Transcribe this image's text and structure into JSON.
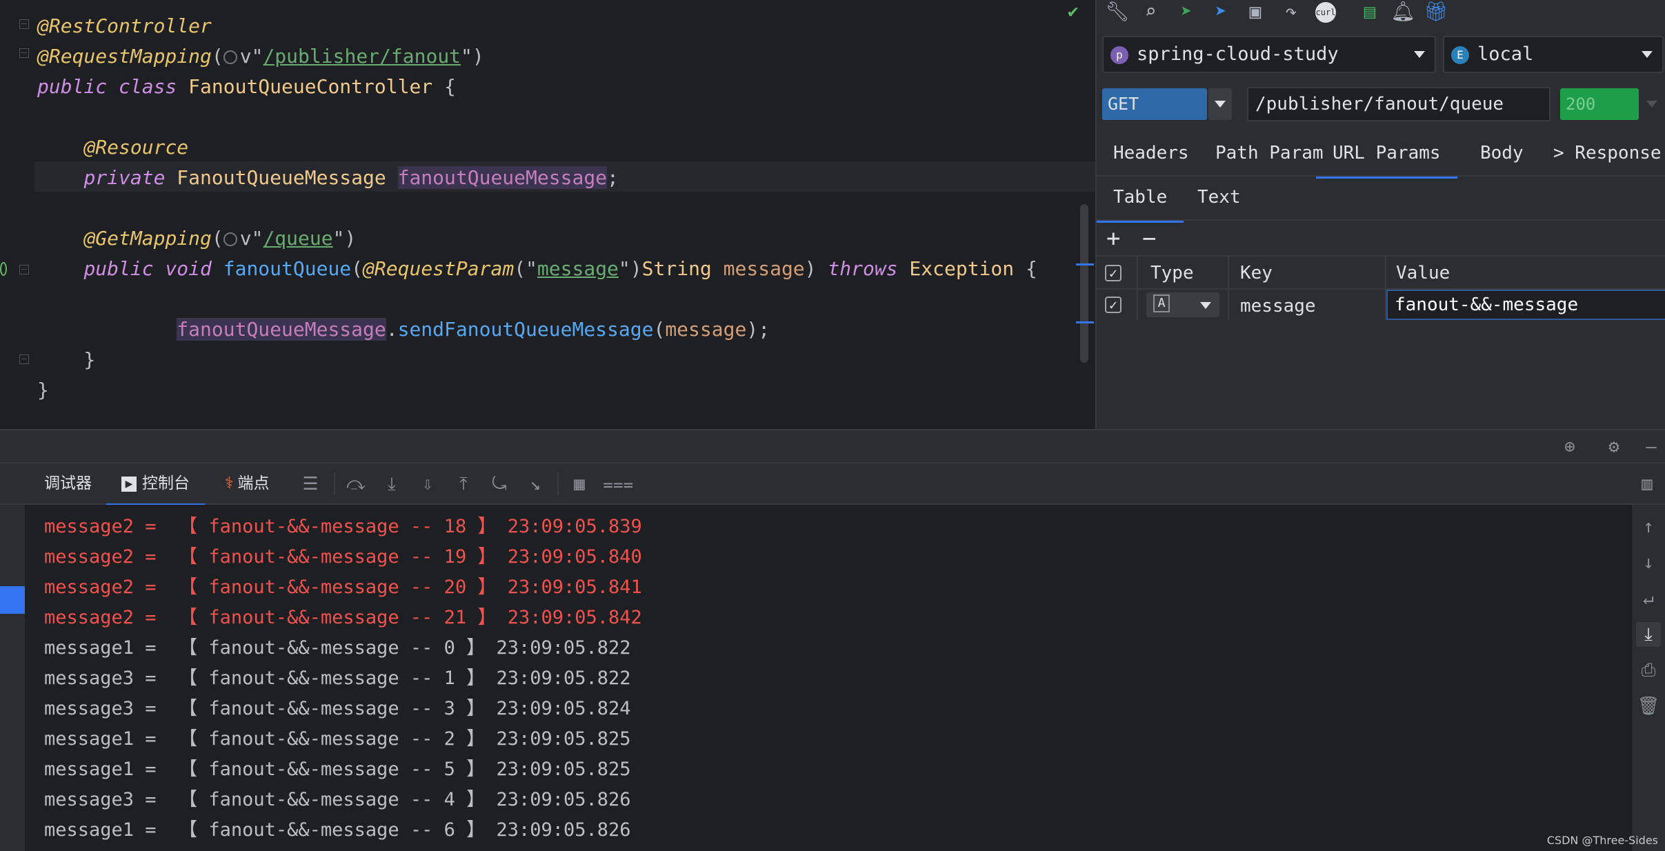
{
  "editor": {
    "lines": [
      {
        "id": "l1",
        "parts": [
          {
            "c": "ann",
            "t": "@RestController"
          }
        ]
      },
      {
        "id": "l2",
        "parts": [
          {
            "c": "ann",
            "t": "@RequestMapping"
          },
          {
            "c": "txt",
            "t": "("
          },
          {
            "c": "globe",
            "t": ""
          },
          {
            "c": "txt",
            "t": "v\""
          },
          {
            "c": "url",
            "t": "/publisher/fanout"
          },
          {
            "c": "txt",
            "t": "\")"
          }
        ]
      },
      {
        "id": "l3",
        "parts": [
          {
            "c": "k",
            "t": "public class "
          },
          {
            "c": "cls",
            "t": "FanoutQueueController"
          },
          {
            "c": "txt",
            "t": " {"
          }
        ]
      },
      {
        "id": "l4",
        "parts": []
      },
      {
        "id": "l5",
        "parts": [
          {
            "c": "txt",
            "t": "    "
          },
          {
            "c": "ann",
            "t": "@Resource"
          }
        ]
      },
      {
        "id": "l6",
        "parts": [
          {
            "c": "txt",
            "t": "    "
          },
          {
            "c": "k",
            "t": "private "
          },
          {
            "c": "cls",
            "t": "FanoutQueueMessage "
          },
          {
            "c": "fldbg",
            "t": "fanoutQueueMessage"
          },
          {
            "c": "txt",
            "t": ";"
          }
        ]
      },
      {
        "id": "l7",
        "parts": []
      },
      {
        "id": "l8",
        "parts": [
          {
            "c": "txt",
            "t": "    "
          },
          {
            "c": "ann",
            "t": "@GetMapping"
          },
          {
            "c": "txt",
            "t": "("
          },
          {
            "c": "globe",
            "t": ""
          },
          {
            "c": "txt",
            "t": "v\""
          },
          {
            "c": "url",
            "t": "/queue"
          },
          {
            "c": "txt",
            "t": "\")"
          }
        ]
      },
      {
        "id": "l9",
        "parts": [
          {
            "c": "txt",
            "t": "    "
          },
          {
            "c": "k",
            "t": "public void "
          },
          {
            "c": "mth",
            "t": "fanoutQueue"
          },
          {
            "c": "txt",
            "t": "("
          },
          {
            "c": "ann",
            "t": "@RequestParam"
          },
          {
            "c": "txt",
            "t": "(\""
          },
          {
            "c": "url",
            "t": "message"
          },
          {
            "c": "txt",
            "t": "\")"
          },
          {
            "c": "cls",
            "t": "String "
          },
          {
            "c": "par",
            "t": "message"
          },
          {
            "c": "txt",
            "t": ") "
          },
          {
            "c": "k",
            "t": "throws "
          },
          {
            "c": "cls",
            "t": "Exception"
          },
          {
            "c": "txt",
            "t": " {"
          }
        ]
      },
      {
        "id": "l10",
        "parts": []
      },
      {
        "id": "l11",
        "parts": [
          {
            "c": "txt",
            "t": "            "
          },
          {
            "c": "fldbg",
            "t": "fanoutQueueMessage"
          },
          {
            "c": "txt",
            "t": "."
          },
          {
            "c": "mth",
            "t": "sendFanoutQueueMessage"
          },
          {
            "c": "txt",
            "t": "("
          },
          {
            "c": "par",
            "t": "message"
          },
          {
            "c": "txt",
            "t": ");"
          }
        ]
      },
      {
        "id": "l12",
        "parts": [
          {
            "c": "txt",
            "t": "    }"
          }
        ]
      },
      {
        "id": "l13",
        "parts": [
          {
            "c": "txt",
            "t": "}"
          }
        ]
      }
    ]
  },
  "rest": {
    "project": "spring-cloud-study",
    "project_badge": "p",
    "env": "local",
    "env_badge": "E",
    "method": "GET",
    "url": "/publisher/fanout/queue",
    "status": "200",
    "tabs": [
      "Headers",
      "Path Param",
      "URL Params",
      "Body",
      "> Response"
    ],
    "subtabs": [
      "Table",
      "Text"
    ],
    "add": "+",
    "remove": "−",
    "table_headers": {
      "type": "Type",
      "key": "Key",
      "value": "Value"
    },
    "row": {
      "type": "A",
      "key": "message",
      "value": "fanout-&&-message"
    }
  },
  "bottom": {
    "tabs": {
      "debugger": "调试器",
      "console": "控制台",
      "breakpoints": "端点"
    },
    "console_lines": [
      {
        "style": "err",
        "text": "message2 =  【 fanout-&&-message -- 18 】 23:09:05.839"
      },
      {
        "style": "err",
        "text": "message2 =  【 fanout-&&-message -- 19 】 23:09:05.840"
      },
      {
        "style": "err",
        "text": "message2 =  【 fanout-&&-message -- 20 】 23:09:05.841"
      },
      {
        "style": "err",
        "text": "message2 =  【 fanout-&&-message -- 21 】 23:09:05.842"
      },
      {
        "style": "std",
        "text": "message1 =  【 fanout-&&-message -- 0 】 23:09:05.822"
      },
      {
        "style": "std",
        "text": "message3 =  【 fanout-&&-message -- 1 】 23:09:05.822"
      },
      {
        "style": "std",
        "text": "message3 =  【 fanout-&&-message -- 3 】 23:09:05.824"
      },
      {
        "style": "std",
        "text": "message1 =  【 fanout-&&-message -- 2 】 23:09:05.825"
      },
      {
        "style": "std",
        "text": "message1 =  【 fanout-&&-message -- 5 】 23:09:05.825"
      },
      {
        "style": "std",
        "text": "message3 =  【 fanout-&&-message -- 4 】 23:09:05.826"
      },
      {
        "style": "std",
        "text": "message1 =  【 fanout-&&-message -- 6 】 23:09:05.826"
      }
    ]
  },
  "watermark": "CSDN @Three-Sides",
  "colors": {
    "accent": "#3574f0",
    "status_ok": "#1f9e4a",
    "error_text": "#f0524f"
  }
}
